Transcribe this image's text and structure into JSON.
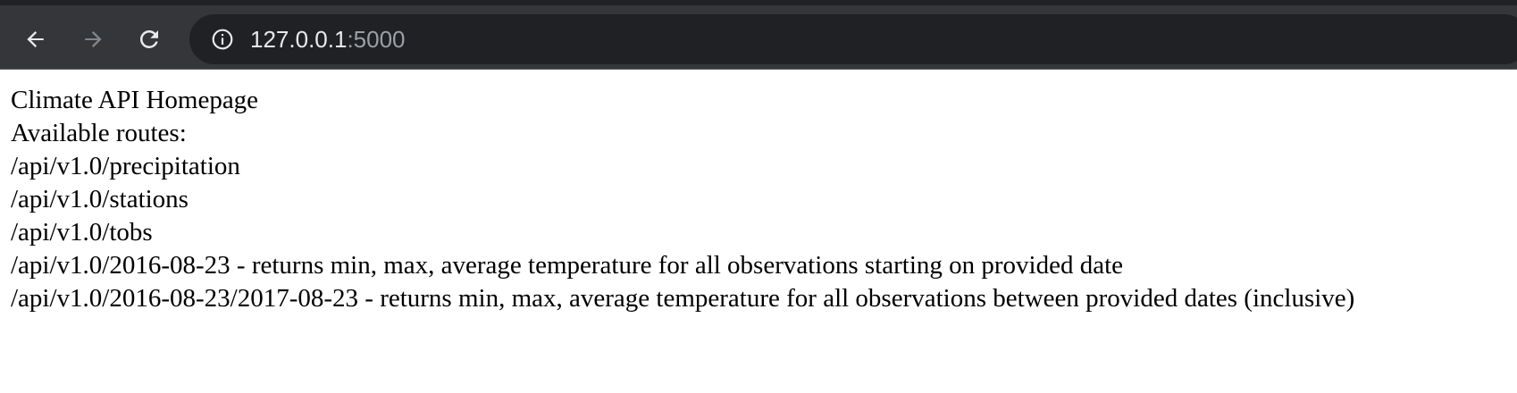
{
  "browser": {
    "address": {
      "host": "127.0.0.1",
      "port": ":5000"
    },
    "icons": {
      "back": "back-arrow-icon",
      "forward": "forward-arrow-icon",
      "reload": "reload-icon",
      "info": "info-icon"
    }
  },
  "page": {
    "title": "Climate API Homepage",
    "subtitle": "Available routes:",
    "routes": [
      "/api/v1.0/precipitation",
      "/api/v1.0/stations",
      "/api/v1.0/tobs",
      "/api/v1.0/2016-08-23 - returns min, max, average temperature for all observations starting on provided date",
      "/api/v1.0/2016-08-23/2017-08-23 - returns min, max, average temperature for all observations between provided dates (inclusive)"
    ]
  },
  "colors": {
    "toolbar_bg": "#35363a",
    "omnibox_bg": "#202124",
    "icon_active": "#e8eaed",
    "icon_disabled": "#80868b",
    "url_port": "#9aa0a6",
    "page_text": "#000000"
  }
}
